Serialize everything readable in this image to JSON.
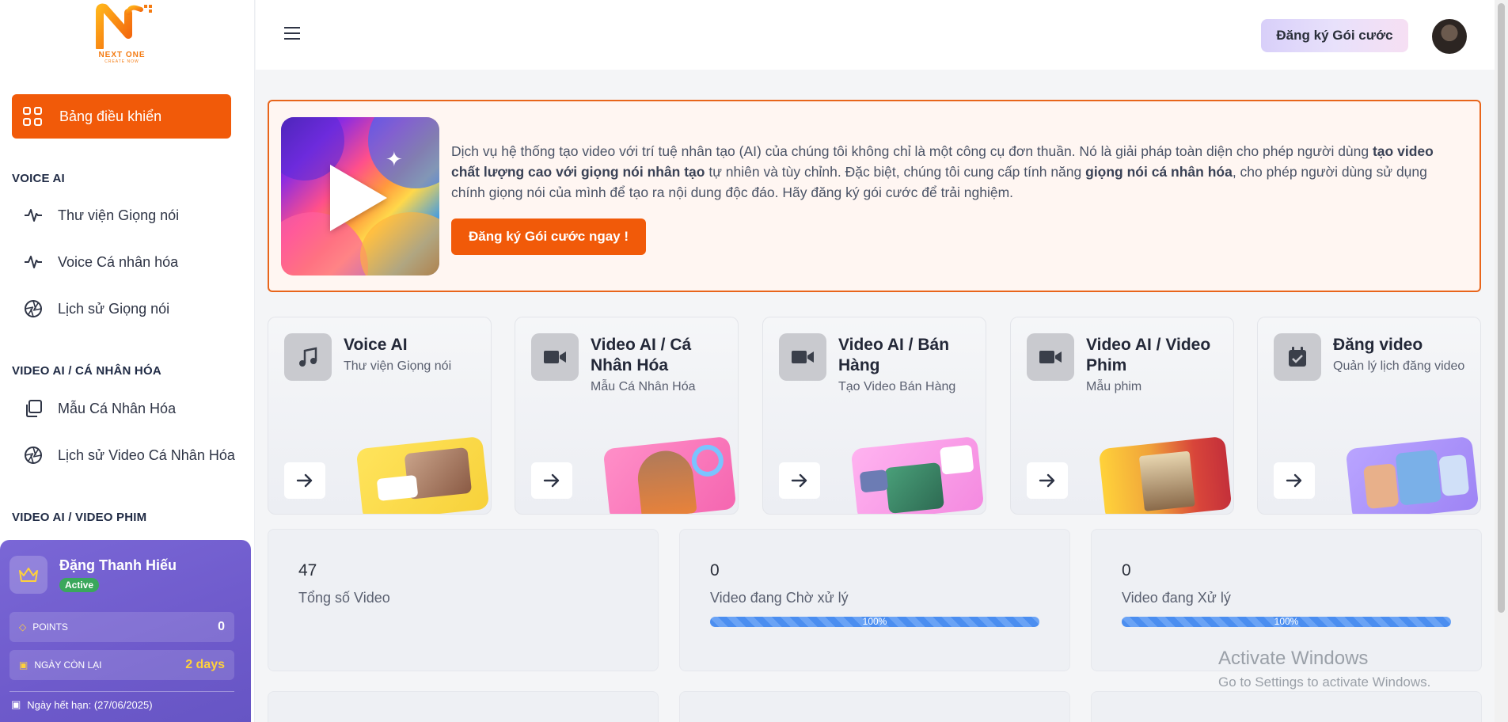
{
  "brand": {
    "name": "NEXT ONE",
    "tagline": "CREATE NOW"
  },
  "sidebar": {
    "active_label": "Bảng điều khiển",
    "sections": [
      {
        "title": "VOICE AI"
      },
      {
        "title": "VIDEO AI / CÁ NHÂN HÓA"
      },
      {
        "title": "VIDEO AI / VIDEO PHIM"
      }
    ],
    "items": [
      {
        "label": "Thư viện Giọng nói",
        "icon": "waveform-icon"
      },
      {
        "label": "Voice Cá nhân hóa",
        "icon": "waveform-icon"
      },
      {
        "label": "Lịch sử Giọng nói",
        "icon": "aperture-icon"
      },
      {
        "label": "Mẫu Cá Nhân Hóa",
        "icon": "copy-icon"
      },
      {
        "label": "Lịch sử Video Cá Nhân Hóa",
        "icon": "aperture-icon"
      }
    ]
  },
  "user": {
    "name": "Đặng Thanh Hiếu",
    "status": "Active",
    "points_label": "POINTS",
    "points_value": "0",
    "days_label": "NGÀY CÒN LẠI",
    "days_value": "2 days",
    "expiry": "Ngày hết hạn: (27/06/2025)"
  },
  "header": {
    "subscribe_label": "Đăng ký Gói cước"
  },
  "banner": {
    "text_1": "Dịch vụ hệ thống tạo video với trí tuệ nhân tạo (AI) của chúng tôi không chỉ là một công cụ đơn thuần. Nó là giải pháp toàn diện cho phép người dùng ",
    "bold_1": "tạo video chất lượng cao với giọng nói nhân tạo",
    "text_2": " tự nhiên và tùy chỉnh. Đặc biệt, chúng tôi cung cấp tính năng ",
    "bold_2": "giọng nói cá nhân hóa",
    "text_3": ", cho phép người dùng sử dụng chính giọng nói của mình để tạo ra nội dung độc đáo. Hãy đăng ký gói cước để trải nghiệm.",
    "button_label": "Đăng ký Gói cước ngay !"
  },
  "features": [
    {
      "title": "Voice AI",
      "subtitle": "Thư viện Giọng nói",
      "icon": "music-note-icon"
    },
    {
      "title": "Video AI / Cá Nhân Hóa",
      "subtitle": "Mẫu Cá Nhân Hóa",
      "icon": "video-camera-icon"
    },
    {
      "title": "Video AI / Bán Hàng",
      "subtitle": "Tạo Video Bán Hàng",
      "icon": "video-camera-icon"
    },
    {
      "title": "Video AI / Video Phim",
      "subtitle": "Mẫu phim",
      "icon": "video-camera-icon"
    },
    {
      "title": "Đăng video",
      "subtitle": "Quản lý lịch đăng video",
      "icon": "calendar-check-icon"
    }
  ],
  "stats": [
    {
      "value": "47",
      "label": "Tổng số Video"
    },
    {
      "value": "0",
      "label": "Video đang Chờ xử lý",
      "progress": "100%"
    },
    {
      "value": "0",
      "label": "Video đang Xử lý",
      "progress": "100%"
    }
  ],
  "watermark": {
    "line1": "Activate Windows",
    "line2": "Go to Settings to activate Windows."
  },
  "colors": {
    "accent": "#f15a09",
    "purple": "#6e5acb",
    "bar": "#4b8ef0"
  }
}
